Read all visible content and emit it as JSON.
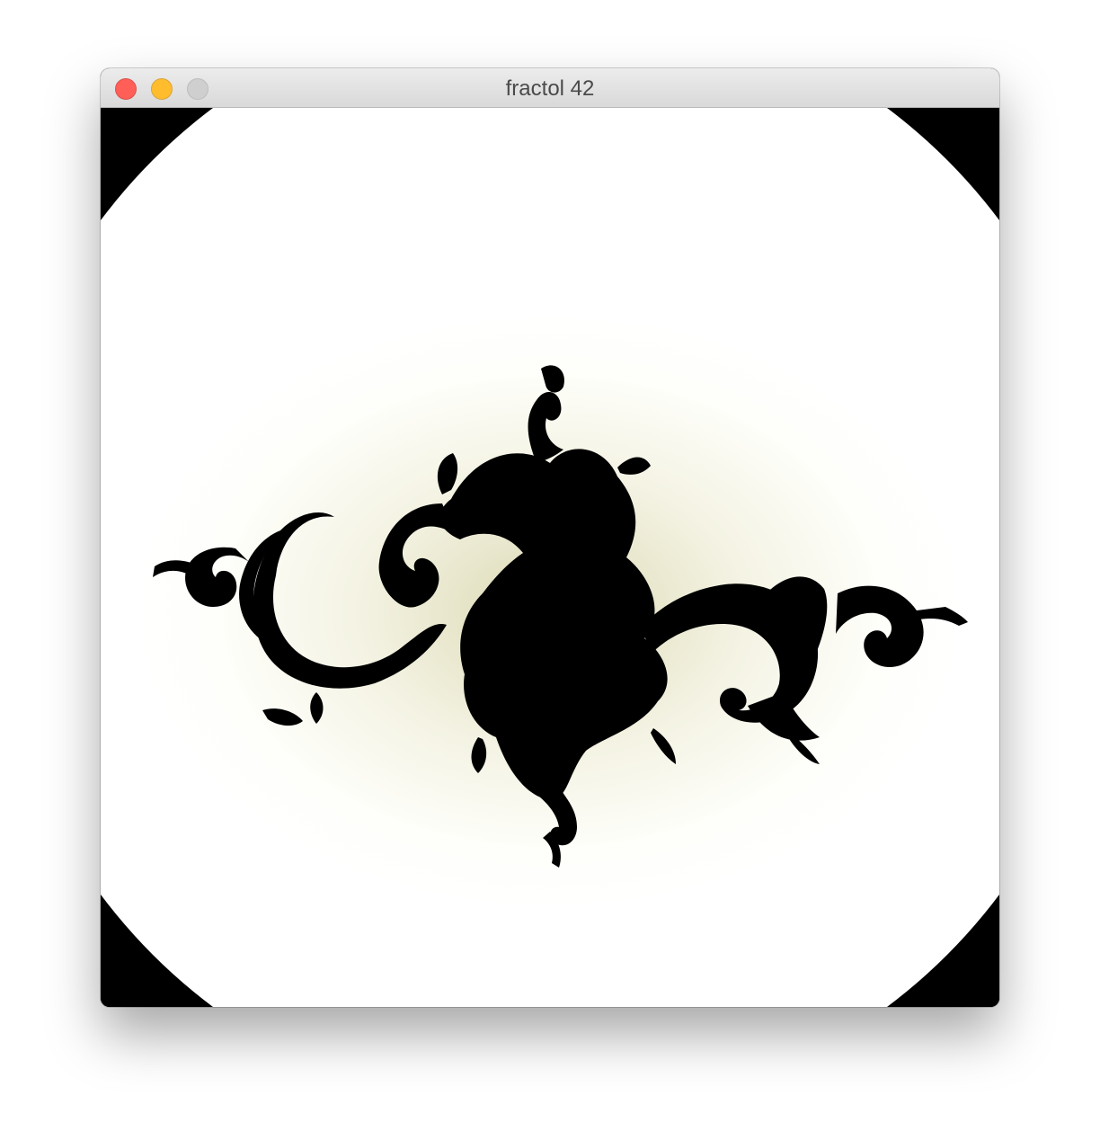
{
  "window": {
    "title": "fractol 42"
  },
  "controls": {
    "close": "close-button",
    "minimize": "minimize-button",
    "zoom": "zoom-button"
  },
  "colors": {
    "close": "#ff5f57",
    "minimize": "#ffbd2e",
    "zoom_disabled": "#cfcfcf",
    "background": "#000000",
    "escape_field": "#ffffff",
    "near_set_glow": "#e8e6c6",
    "set": "#000000"
  }
}
